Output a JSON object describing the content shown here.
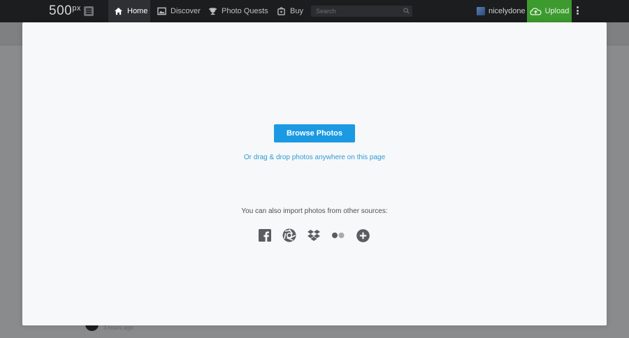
{
  "nav": {
    "logo": "500",
    "logo_sup": "px",
    "items": [
      {
        "label": "Home",
        "icon": "home-icon"
      },
      {
        "label": "Discover",
        "icon": "image-icon"
      },
      {
        "label": "Photo Quests",
        "icon": "trophy-icon"
      },
      {
        "label": "Buy",
        "icon": "bag-icon"
      }
    ],
    "search_placeholder": "Search",
    "username": "nicelydone",
    "upload_label": "Upload"
  },
  "background": {
    "time": "3 hours ago"
  },
  "modal": {
    "browse_label": "Browse Photos",
    "drag_text": "Or drag & drop photos anywhere on this page",
    "import_text": "You can also import photos from other sources:",
    "sources": [
      "facebook-icon",
      "picasa-icon",
      "dropbox-icon",
      "flickr-icon",
      "add-source-icon"
    ]
  },
  "colors": {
    "nav_bg": "#1c1d1f",
    "upload_green": "#3c9a2f",
    "browse_blue": "#1b9ae3",
    "link_blue": "#2f9bd6"
  }
}
